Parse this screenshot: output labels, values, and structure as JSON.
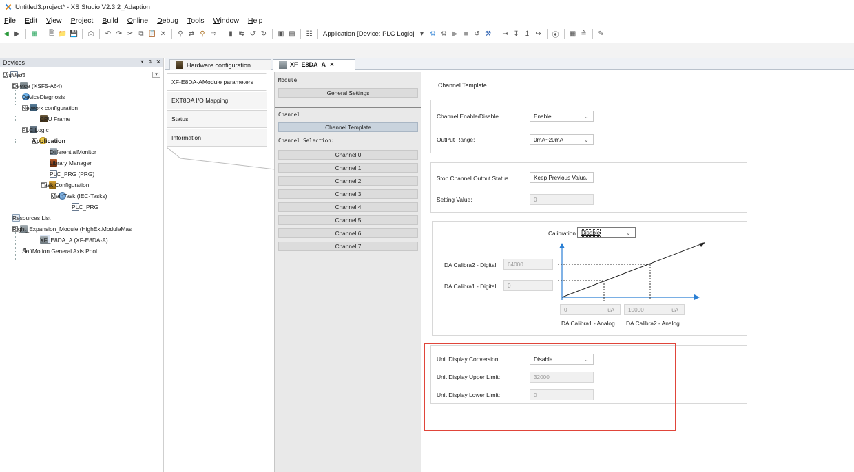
{
  "window": {
    "title": "Untitled3.project* - XS Studio V2.3.2_Adaption"
  },
  "menu": [
    "File",
    "Edit",
    "View",
    "Project",
    "Build",
    "Online",
    "Debug",
    "Tools",
    "Window",
    "Help"
  ],
  "toolbar": {
    "application_label": "Application [Device: PLC Logic]"
  },
  "devices_panel": {
    "title": "Devices",
    "pin_label": "▾ ȣ ×",
    "tree": [
      {
        "label": "Untitled3",
        "icon": "project-icon"
      },
      {
        "label": "Device (XSF5-A64)",
        "icon": "device-icon"
      },
      {
        "label": "DeviceDiagnosis",
        "icon": "diagnosis-icon"
      },
      {
        "label": "Network configuration",
        "icon": "network-icon"
      },
      {
        "label": "CPU Frame",
        "icon": "cpu-frame-icon"
      },
      {
        "label": "PLC Logic",
        "icon": "plc-logic-icon"
      },
      {
        "label": "Application",
        "icon": "application-icon"
      },
      {
        "label": "DifferentialMonitor",
        "icon": "monitor-icon"
      },
      {
        "label": "Library Manager",
        "icon": "library-icon"
      },
      {
        "label": "PLC_PRG (PRG)",
        "icon": "program-icon"
      },
      {
        "label": "Task Configuration",
        "icon": "task-icon"
      },
      {
        "label": "MainTask (IEC-Tasks)",
        "icon": "maintask-icon"
      },
      {
        "label": "PLC_PRG",
        "icon": "program-call-icon"
      },
      {
        "label": "Resources List",
        "icon": "resources-icon"
      },
      {
        "label": "Right_Expansion_Module (HighExtModuleMas",
        "icon": "module-icon"
      },
      {
        "label": "XF_E8DA_A (XF-E8DA-A)",
        "icon": "module-icon"
      },
      {
        "label": "SoftMotion General Axis Pool",
        "icon": "axis-pool-icon"
      }
    ]
  },
  "editor_tabs": [
    {
      "label": "Hardware configuration"
    },
    {
      "label": "XF_E8DA_A",
      "close": "×"
    }
  ],
  "nav": [
    "XF-E8DA-AModule parameters",
    "EXT8DA I/O Mapping",
    "Status",
    "Information"
  ],
  "module_col": {
    "module_label": "Module",
    "general_settings": "General Settings",
    "channel_label": "Channel",
    "channel_template": "Channel Template",
    "channel_selection": "Channel Selection:",
    "channels": [
      "Channel 0",
      "Channel 1",
      "Channel 2",
      "Channel 3",
      "Channel 4",
      "Channel 5",
      "Channel 6",
      "Channel 7"
    ]
  },
  "content": {
    "heading": "Channel Template",
    "enable_label": "Channel Enable/Disable",
    "enable_value": "Enable",
    "range_label": "OutPut Range:",
    "range_value": "0mA~20mA",
    "stop_label": "Stop Channel Output Status",
    "stop_value": "Keep Previous Value",
    "setting_label": "Setting Value:",
    "setting_value": "0",
    "calibration_label": "Calibration",
    "calibration_value": "Disable",
    "calibra2_label": "DA Calibra2 - Digital",
    "calibra2_value": "64000",
    "calibra1_label": "DA Calibra1 - Digital",
    "calibra1_value": "0",
    "analog1_value": "0",
    "analog2_value": "10000",
    "unit": "uA",
    "analog1_label": "DA Calibra1 - Analog",
    "analog2_label": "DA Calibra2 - Analog",
    "unit_conv_label": "Unit Display Conversion",
    "unit_conv_value": "Disable",
    "upper_label": "Unit Display Upper Limit:",
    "upper_value": "32000",
    "lower_label": "Unit Display Lower Limit:",
    "lower_value": "0"
  },
  "colors": {
    "highlight": "#e0453a",
    "selected_button": "#c9d3dd",
    "panel_header": "#dfe3e9"
  }
}
